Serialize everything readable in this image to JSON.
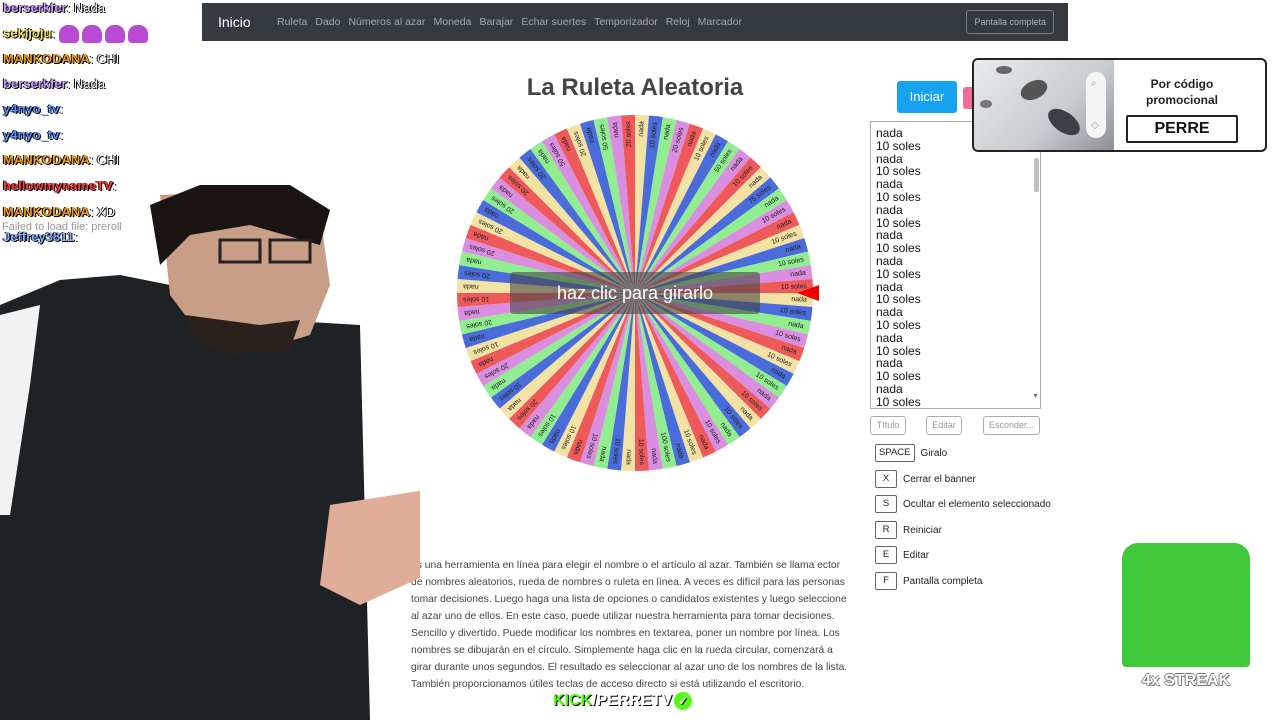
{
  "navbar": {
    "brand": "Inicio",
    "links": [
      "Ruleta",
      "Dado",
      "Números al azar",
      "Moneda",
      "Barajar",
      "Echar suertes",
      "Temporizador",
      "Reloj",
      "Marcador"
    ],
    "fullscreen": "Pantalla completa"
  },
  "page": {
    "title": "La Ruleta Aleatoria",
    "spin_overlay": "haz clic para girarlo"
  },
  "wheel": {
    "segments": [
      "nada",
      "10 soles",
      "nada",
      "20 soles",
      "nada",
      "10 soles",
      "nada",
      "50 soles",
      "nada",
      "10 soles",
      "nada",
      "75 soles",
      "nada",
      "10 soles",
      "nada",
      "10 soles",
      "nada",
      "10 soles",
      "nada",
      "10 soles",
      "nada",
      "10 soles",
      "nada",
      "10 soles",
      "nada",
      "10 soles",
      "nada",
      "10 soles",
      "nada",
      "10 soles",
      "nada",
      "10 soles",
      "nada",
      "10 soles",
      "nada",
      "10 soles",
      "nada",
      "100 soles",
      "nada",
      "10 soles",
      "nada",
      "10 soles",
      "nada",
      "10 soles",
      "nada",
      "10 soles",
      "nada",
      "10 soles",
      "nada",
      "20 soles",
      "nada",
      "10 soles",
      "nada",
      "20 soles",
      "nada",
      "10 soles",
      "nada",
      "20 soles",
      "nada",
      "10 soles",
      "nada",
      "20 soles",
      "nada",
      "20 soles",
      "nada",
      "20 soles",
      "nada",
      "20 soles",
      "nada",
      "20 soles",
      "nada",
      "20 soles",
      "nada",
      "50 soles",
      "nada",
      "20 soles",
      "nada",
      "50 soles",
      "nada",
      "20 soles"
    ],
    "colors": [
      "#f2e2a4",
      "#4a6cdb",
      "#90ee90",
      "#d98ee0",
      "#ee5a5a"
    ]
  },
  "controls": {
    "start": "Iniciar",
    "names": [
      "nada",
      "10 soles",
      "nada",
      "10 soles",
      "nada",
      "10 soles",
      "nada",
      "10 soles",
      "nada",
      "10 soles",
      "nada",
      "10 soles",
      "nada",
      "10 soles",
      "nada",
      "10 soles",
      "nada",
      "10 soles",
      "nada",
      "10 soles",
      "nada",
      "10 soles"
    ],
    "title_btn": "Título",
    "edit_btn": "Editar",
    "hide_btn": "Esconder...",
    "shortcuts": [
      {
        "key": "SPACE",
        "label": "Giralo"
      },
      {
        "key": "X",
        "label": "Cerrar el banner"
      },
      {
        "key": "S",
        "label": "Ocultar el elemento seleccionado"
      },
      {
        "key": "R",
        "label": "Reiniciar"
      },
      {
        "key": "E",
        "label": "Editar"
      },
      {
        "key": "F",
        "label": "Pantalla completa"
      }
    ]
  },
  "description": "es una herramienta en línea para elegir el nombre o el artículo al azar. También se llama ector de nombres aleatorios, rueda de nombres o ruleta en línea. A veces es difícil para las personas tomar decisiones. Luego haga una lista de opciones o candidatos existentes y luego seleccione al azar uno de ellos. En este caso, puede utilizar nuestra herramienta para tomar decisiones. Sencillo y divertido. Puede modificar los nombres en textarea, poner un nombre por línea. Los nombres se dibujarán en el círculo. Simplemente haga clic en la rueda circular, comenzará a girar durante unos segundos. El resultado es seleccionar al azar uno de los nombres de la lista. También proporcionamos útiles teclas de acceso directo si está utilizando el escritorio.",
  "promo": {
    "text": "Por código promocional",
    "code": "PERRE"
  },
  "chat": [
    {
      "user": "berserkfer",
      "msg": "Nada",
      "color": "#c8a0ff"
    },
    {
      "user": "sekijoju",
      "msg": "",
      "color": "#f0e060",
      "emotes": 4
    },
    {
      "user": "MANKODANA",
      "msg": "CHI",
      "color": "#f0a020"
    },
    {
      "user": "berserkfer",
      "msg": "Nada",
      "color": "#c8a0ff"
    },
    {
      "user": "y4nyo_tv",
      "msg": "",
      "color": "#6090ff"
    },
    {
      "user": "y4nyo_tv",
      "msg": "",
      "color": "#6090ff"
    },
    {
      "user": "MANKODANA",
      "msg": "CHI",
      "color": "#f0a020"
    },
    {
      "user": "hellowmynameTV",
      "msg": "",
      "color": "#ff4040"
    },
    {
      "user": "MANKODANA",
      "msg": "XD",
      "color": "#f0a020"
    },
    {
      "user": "Jeffrey3811",
      "msg": "",
      "color": "#8ab0ff"
    }
  ],
  "preroll_error": "Failed to load file: preroll",
  "streak": "4x STREAK",
  "kick": {
    "k": "KICK",
    "rest": "/PERRETV"
  }
}
